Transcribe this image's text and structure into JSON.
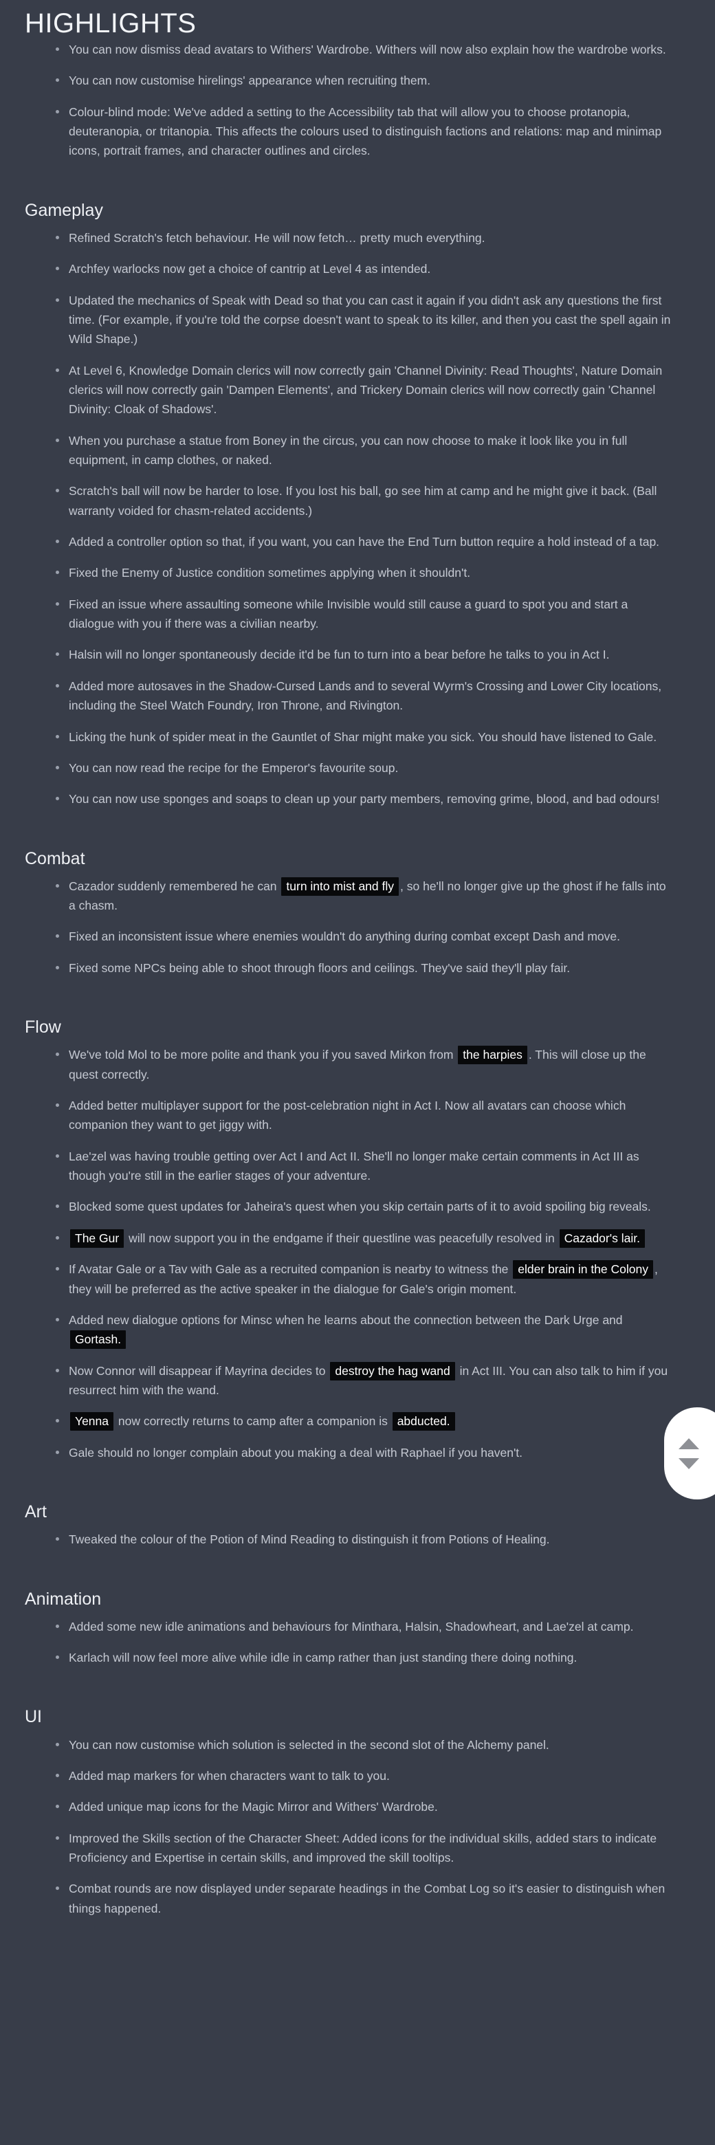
{
  "page": {
    "title": "HIGHLIGHTS",
    "background_color": "#383d49",
    "text_color": "#c5c9d2",
    "heading_color": "#eef0f4",
    "spoiler_bg": "#08090b",
    "spoiler_color": "#ffffff"
  },
  "highlights": {
    "items": [
      "You can now dismiss dead avatars to Withers' Wardrobe. Withers will now also explain how the wardrobe works.",
      "You can now customise hirelings' appearance when recruiting them.",
      "Colour-blind mode: We've added a setting to the Accessibility tab that will allow you to choose protanopia, deuteranopia, or tritanopia. This affects the colours used to distinguish factions and relations: map and minimap icons, portrait frames, and character outlines and circles."
    ]
  },
  "sections": [
    {
      "heading": "Gameplay",
      "items": [
        {
          "parts": [
            {
              "type": "text",
              "value": "Refined Scratch's fetch behaviour. He will now fetch… pretty much everything."
            }
          ]
        },
        {
          "parts": [
            {
              "type": "text",
              "value": "Archfey warlocks now get a choice of cantrip at Level 4 as intended."
            }
          ]
        },
        {
          "parts": [
            {
              "type": "text",
              "value": "Updated the mechanics of Speak with Dead so that you can cast it again if you didn't ask any questions the first time. (For example, if you're told the corpse doesn't want to speak to its killer, and then you cast the spell again in Wild Shape.)"
            }
          ]
        },
        {
          "parts": [
            {
              "type": "text",
              "value": "At Level 6, Knowledge Domain clerics will now correctly gain 'Channel Divinity: Read Thoughts', Nature Domain clerics will now correctly gain 'Dampen Elements', and Trickery Domain clerics will now correctly gain 'Channel Divinity: Cloak of Shadows'."
            }
          ]
        },
        {
          "parts": [
            {
              "type": "text",
              "value": "When you purchase a statue from Boney in the circus, you can now choose to make it look like you in full equipment, in camp clothes, or naked."
            }
          ]
        },
        {
          "parts": [
            {
              "type": "text",
              "value": "Scratch's ball will now be harder to lose. If you lost his ball, go see him at camp and he might give it back. (Ball warranty voided for chasm-related accidents.)"
            }
          ]
        },
        {
          "parts": [
            {
              "type": "text",
              "value": "Added a controller option so that, if you want, you can have the End Turn button require a hold instead of a tap."
            }
          ]
        },
        {
          "parts": [
            {
              "type": "text",
              "value": "Fixed the Enemy of Justice condition sometimes applying when it shouldn't."
            }
          ]
        },
        {
          "parts": [
            {
              "type": "text",
              "value": "Fixed an issue where assaulting someone while Invisible would still cause a guard to spot you and start a dialogue with you if there was a civilian nearby."
            }
          ]
        },
        {
          "parts": [
            {
              "type": "text",
              "value": "Halsin will no longer spontaneously decide it'd be fun to turn into a bear before he talks to you in Act I."
            }
          ]
        },
        {
          "parts": [
            {
              "type": "text",
              "value": "Added more autosaves in the Shadow-Cursed Lands and to several Wyrm's Crossing and Lower City locations, including the Steel Watch Foundry, Iron Throne, and Rivington."
            }
          ]
        },
        {
          "parts": [
            {
              "type": "text",
              "value": "Licking the hunk of spider meat in the Gauntlet of Shar might make you sick. You should have listened to Gale."
            }
          ]
        },
        {
          "parts": [
            {
              "type": "text",
              "value": "You can now read the recipe for the Emperor's favourite soup."
            }
          ]
        },
        {
          "parts": [
            {
              "type": "text",
              "value": "You can now use sponges and soaps to clean up your party members, removing grime, blood, and bad odours!"
            }
          ]
        }
      ]
    },
    {
      "heading": "Combat",
      "items": [
        {
          "parts": [
            {
              "type": "text",
              "value": "Cazador suddenly remembered he can "
            },
            {
              "type": "spoiler",
              "value": "turn into mist and fly"
            },
            {
              "type": "text",
              "value": ", so he'll no longer give up the ghost if he falls into a chasm."
            }
          ]
        },
        {
          "parts": [
            {
              "type": "text",
              "value": "Fixed an inconsistent issue where enemies wouldn't do anything during combat except Dash and move."
            }
          ]
        },
        {
          "parts": [
            {
              "type": "text",
              "value": "Fixed some NPCs being able to shoot through floors and ceilings. They've said they'll play fair."
            }
          ]
        }
      ]
    },
    {
      "heading": "Flow",
      "items": [
        {
          "parts": [
            {
              "type": "text",
              "value": "We've told Mol to be more polite and thank you if you saved Mirkon from "
            },
            {
              "type": "spoiler",
              "value": "the harpies"
            },
            {
              "type": "text",
              "value": ". This will close up the quest correctly."
            }
          ]
        },
        {
          "parts": [
            {
              "type": "text",
              "value": "Added better multiplayer support for the post-celebration night in Act I. Now all avatars can choose which companion they want to get jiggy with."
            }
          ]
        },
        {
          "parts": [
            {
              "type": "text",
              "value": "Lae'zel was having trouble getting over Act I and Act II. She'll no longer make certain comments in Act III as though you're still in the earlier stages of your adventure."
            }
          ]
        },
        {
          "parts": [
            {
              "type": "text",
              "value": "Blocked some quest updates for Jaheira's quest when you skip certain parts of it to avoid spoiling big reveals."
            }
          ]
        },
        {
          "parts": [
            {
              "type": "spoiler",
              "value": "The Gur"
            },
            {
              "type": "text",
              "value": " will now support you in the endgame if their questline was peacefully resolved in "
            },
            {
              "type": "spoiler",
              "value": "Cazador's lair."
            }
          ]
        },
        {
          "parts": [
            {
              "type": "text",
              "value": "If Avatar Gale or a Tav with Gale as a recruited companion is nearby to witness the "
            },
            {
              "type": "spoiler",
              "value": "elder brain in the Colony"
            },
            {
              "type": "text",
              "value": ", they will be preferred as the active speaker in the dialogue for Gale's origin moment."
            }
          ]
        },
        {
          "parts": [
            {
              "type": "text",
              "value": "Added new dialogue options for Minsc when he learns about the connection between the Dark Urge and "
            },
            {
              "type": "spoiler",
              "value": "Gortash."
            }
          ]
        },
        {
          "parts": [
            {
              "type": "text",
              "value": "Now Connor will disappear if Mayrina decides to "
            },
            {
              "type": "spoiler",
              "value": "destroy the hag wand"
            },
            {
              "type": "text",
              "value": " in Act III. You can also talk to him if you resurrect him with the wand."
            }
          ]
        },
        {
          "parts": [
            {
              "type": "spoiler",
              "value": "Yenna"
            },
            {
              "type": "text",
              "value": " now correctly returns to camp after a companion is "
            },
            {
              "type": "spoiler",
              "value": "abducted."
            }
          ]
        },
        {
          "parts": [
            {
              "type": "text",
              "value": "Gale should no longer complain about you making a deal with Raphael if you haven't."
            }
          ]
        }
      ]
    },
    {
      "heading": "Art",
      "items": [
        {
          "parts": [
            {
              "type": "text",
              "value": "Tweaked the colour of the Potion of Mind Reading to distinguish it from Potions of Healing."
            }
          ]
        }
      ]
    },
    {
      "heading": "Animation",
      "items": [
        {
          "parts": [
            {
              "type": "text",
              "value": "Added some new idle animations and behaviours for Minthara, Halsin, Shadowheart, and Lae'zel at camp."
            }
          ]
        },
        {
          "parts": [
            {
              "type": "text",
              "value": "Karlach will now feel more alive while idle in camp rather than just standing there doing nothing."
            }
          ]
        }
      ]
    },
    {
      "heading": "UI",
      "items": [
        {
          "parts": [
            {
              "type": "text",
              "value": "You can now customise which solution is selected in the second slot of the Alchemy panel."
            }
          ]
        },
        {
          "parts": [
            {
              "type": "text",
              "value": "Added map markers for when characters want to talk to you."
            }
          ]
        },
        {
          "parts": [
            {
              "type": "text",
              "value": "Added unique map icons for the Magic Mirror and Withers' Wardrobe."
            }
          ]
        },
        {
          "parts": [
            {
              "type": "text",
              "value": "Improved the Skills section of the Character Sheet: Added icons for the individual skills, added stars to indicate Proficiency and Expertise in certain skills, and improved the skill tooltips."
            }
          ]
        },
        {
          "parts": [
            {
              "type": "text",
              "value": "Combat rounds are now displayed under separate headings in the Combat Log so it's easier to distinguish when things happened."
            }
          ]
        }
      ]
    }
  ],
  "scroll_widget": {
    "up_label": "scroll-up",
    "down_label": "scroll-down"
  }
}
